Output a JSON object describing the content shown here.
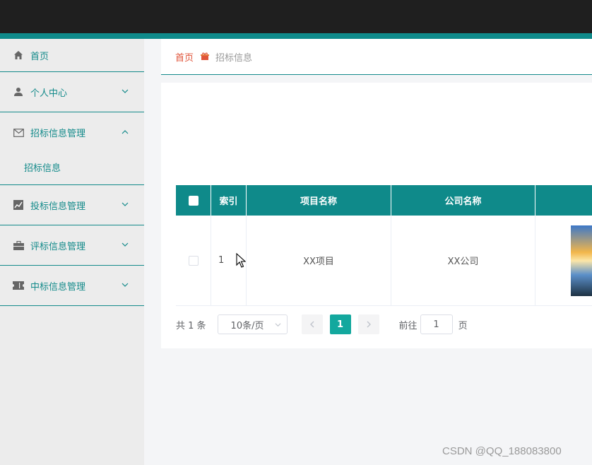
{
  "sidebar": {
    "items": [
      {
        "label": "首页",
        "icon": "home-icon"
      },
      {
        "label": "个人中心",
        "icon": "user-icon"
      },
      {
        "label": "招标信息管理",
        "icon": "mail-icon",
        "expanded": true,
        "children": [
          {
            "label": "招标信息"
          }
        ]
      },
      {
        "label": "投标信息管理",
        "icon": "chart-icon"
      },
      {
        "label": "评标信息管理",
        "icon": "briefcase-icon"
      },
      {
        "label": "中标信息管理",
        "icon": "ticket-icon"
      }
    ]
  },
  "breadcrumb": {
    "home": "首页",
    "current": "招标信息"
  },
  "table": {
    "headers": [
      "索引",
      "项目名称",
      "公司名称"
    ],
    "rows": [
      {
        "index": "1",
        "project": "XX项目",
        "company": "XX公司"
      }
    ]
  },
  "pagination": {
    "total": "共 1 条",
    "page_size": "10条/页",
    "current_page": "1",
    "goto_label": "前往",
    "goto_value": "1",
    "goto_suffix": "页"
  },
  "watermark": "CSDN @QQ_188083800",
  "colors": {
    "primary": "#0f8a8a",
    "accent": "#13a89e",
    "home_link": "#e0543a",
    "topbar": "#1f1f1f"
  }
}
